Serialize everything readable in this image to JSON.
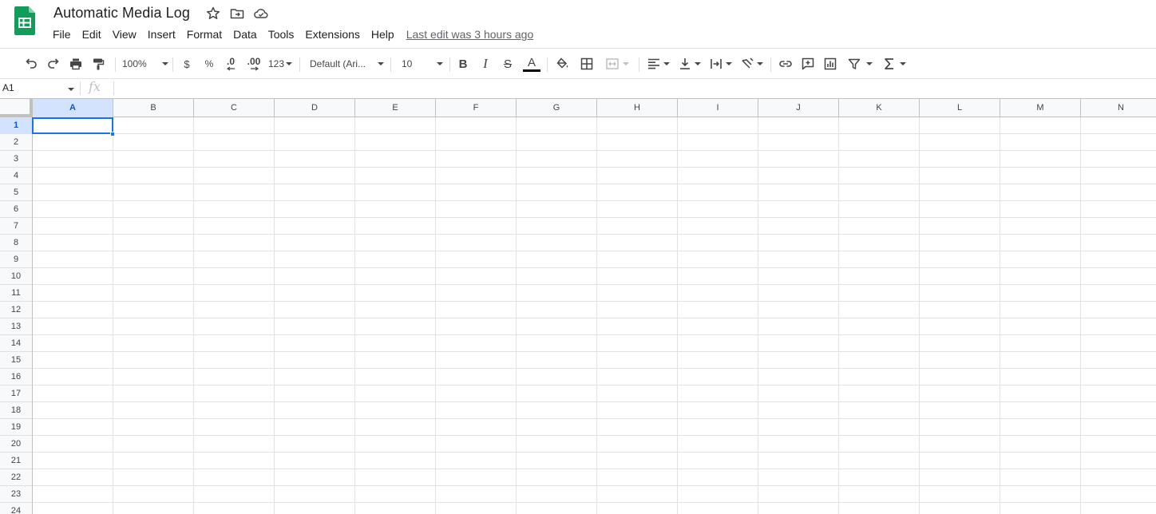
{
  "doc": {
    "title": "Automatic Media Log",
    "last_edit": "Last edit was 3 hours ago",
    "brand_color": "#0f9d58"
  },
  "menu": [
    "File",
    "Edit",
    "View",
    "Insert",
    "Format",
    "Data",
    "Tools",
    "Extensions",
    "Help"
  ],
  "toolbar": {
    "zoom": "100%",
    "currency": "$",
    "percent": "%",
    "decrease_decimal": ".0",
    "increase_decimal": ".00",
    "more_formats": "123",
    "font": "Default (Ari...",
    "font_size": "10",
    "text_color": "#000000"
  },
  "formula_bar": {
    "cell_ref": "A1",
    "fx": "fx",
    "value": ""
  },
  "grid": {
    "columns": [
      "A",
      "B",
      "C",
      "D",
      "E",
      "F",
      "G",
      "H",
      "I",
      "J",
      "K",
      "L",
      "M",
      "N"
    ],
    "rows": [
      "1",
      "2",
      "3",
      "4",
      "5",
      "6",
      "7",
      "8",
      "9",
      "10",
      "11",
      "12",
      "13",
      "14",
      "15",
      "16",
      "17",
      "18",
      "19",
      "20",
      "21",
      "22",
      "23",
      "24"
    ],
    "selected_column": "A",
    "selected_row": "1"
  }
}
